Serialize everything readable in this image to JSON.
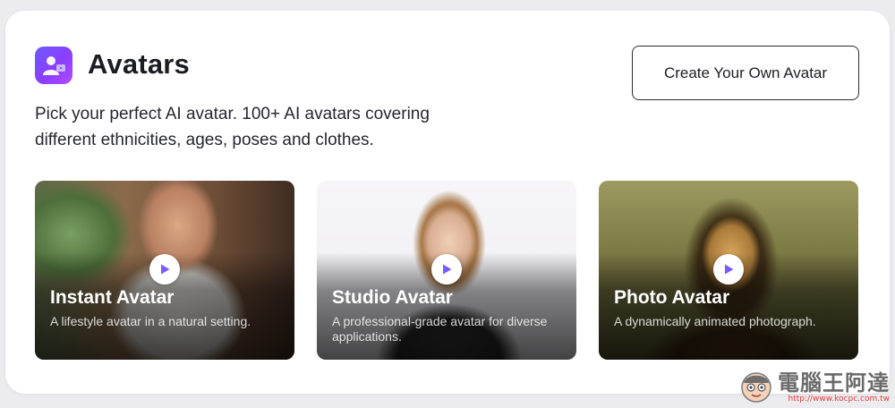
{
  "header": {
    "icon": "avatar-person-icon",
    "title": "Avatars",
    "subtitle": "Pick your perfect AI avatar. 100+ AI avatars covering different ethnicities, ages, poses and clothes.",
    "cta_label": "Create Your Own Avatar"
  },
  "cards": [
    {
      "title": "Instant Avatar",
      "description": "A lifestyle avatar in a natural setting.",
      "icon": "play-icon"
    },
    {
      "title": "Studio Avatar",
      "description": "A professional-grade avatar for diverse applications.",
      "icon": "play-icon"
    },
    {
      "title": "Photo Avatar",
      "description": "A dynamically animated photograph.",
      "icon": "play-icon"
    }
  ],
  "watermark": {
    "brand": "電腦王阿達",
    "url": "http://www.kocpc.com.tw"
  },
  "colors": {
    "accent": "#7b4dff",
    "play_icon": "#7b5cff",
    "title_text": "#1c1d22"
  }
}
